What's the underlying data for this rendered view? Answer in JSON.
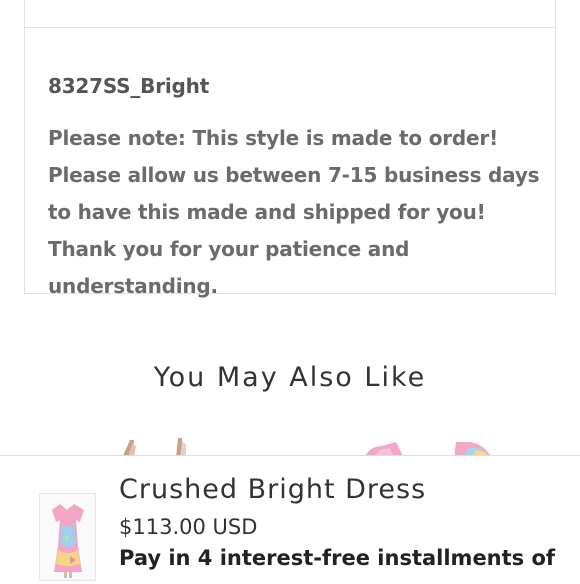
{
  "description": {
    "sku": "8327SS_Bright",
    "note": "Please note: This style is made to order! Please allow us between 7-15 business days to have this made and shipped for you! Thank you for your patience and understanding."
  },
  "recommendations": {
    "title": "You May Also Like"
  },
  "sticky_cart": {
    "product_title": "Crushed Bright Dress",
    "price": "$113.00 USD",
    "installments_text": "Pay in 4 interest-free installments of"
  }
}
